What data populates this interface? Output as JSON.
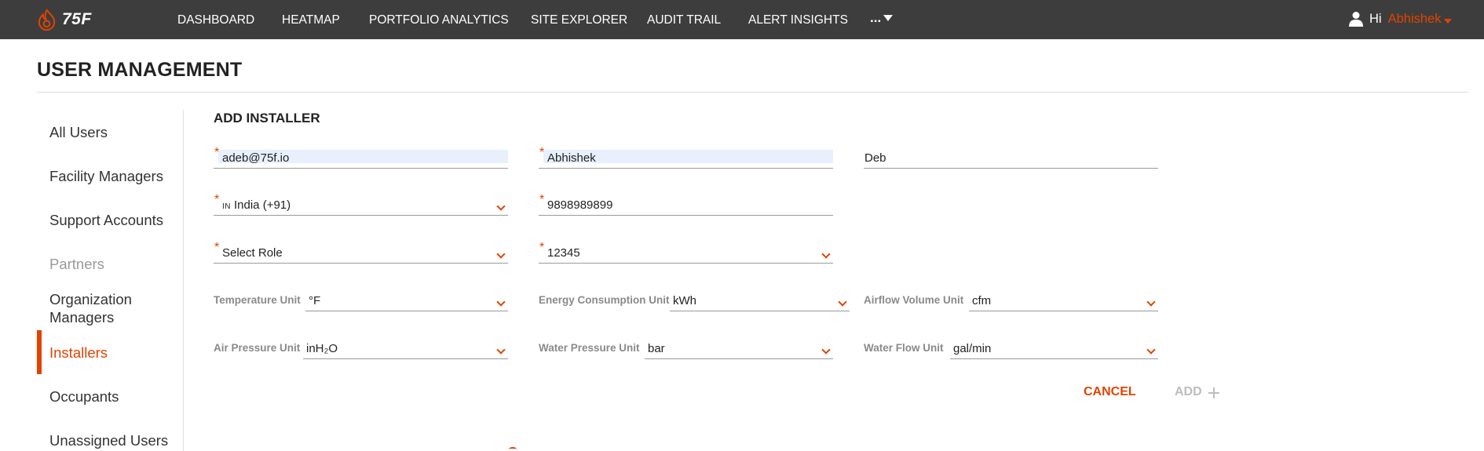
{
  "brand": {
    "logo_text": "75F",
    "accent": "#e24301",
    "topbar_bg": "#3d3d3d"
  },
  "nav": {
    "items": [
      "DASHBOARD",
      "HEATMAP",
      "PORTFOLIO ANALYTICS",
      "SITE EXPLORER",
      "AUDIT TRAIL",
      "ALERT INSIGHTS"
    ],
    "more_label": "..."
  },
  "user": {
    "greeting": "Hi",
    "name": "Abhishek"
  },
  "page": {
    "title": "USER MANAGEMENT"
  },
  "sidebar": {
    "items": [
      {
        "label": "All Users"
      },
      {
        "label": "Facility Managers"
      },
      {
        "label": "Support Accounts"
      },
      {
        "label": "Partners"
      },
      {
        "label": "Organization Managers"
      },
      {
        "label": "Installers"
      },
      {
        "label": "Occupants"
      },
      {
        "label": "Unassigned Users"
      }
    ],
    "active": "Installers"
  },
  "form": {
    "title": "ADD INSTALLER",
    "email": "adeb@75f.io",
    "first_name": "Abhishek",
    "last_name": "Deb",
    "country_flag": "IN",
    "country": "India (+91)",
    "phone": "9898989899",
    "role": "Select Role",
    "code": "12345",
    "units": {
      "temperature": {
        "label": "Temperature Unit",
        "value": "°F"
      },
      "energy": {
        "label": "Energy Consumption Unit",
        "value": "kWh"
      },
      "airflow": {
        "label": "Airflow Volume Unit",
        "value": "cfm"
      },
      "air_pressure": {
        "label": "Air Pressure Unit",
        "value": "inH₂O"
      },
      "water_pressure": {
        "label": "Water Pressure Unit",
        "value": "bar"
      },
      "water_flow": {
        "label": "Water Flow Unit",
        "value": "gal/min"
      }
    },
    "cancel_label": "CANCEL",
    "add_label": "ADD"
  }
}
